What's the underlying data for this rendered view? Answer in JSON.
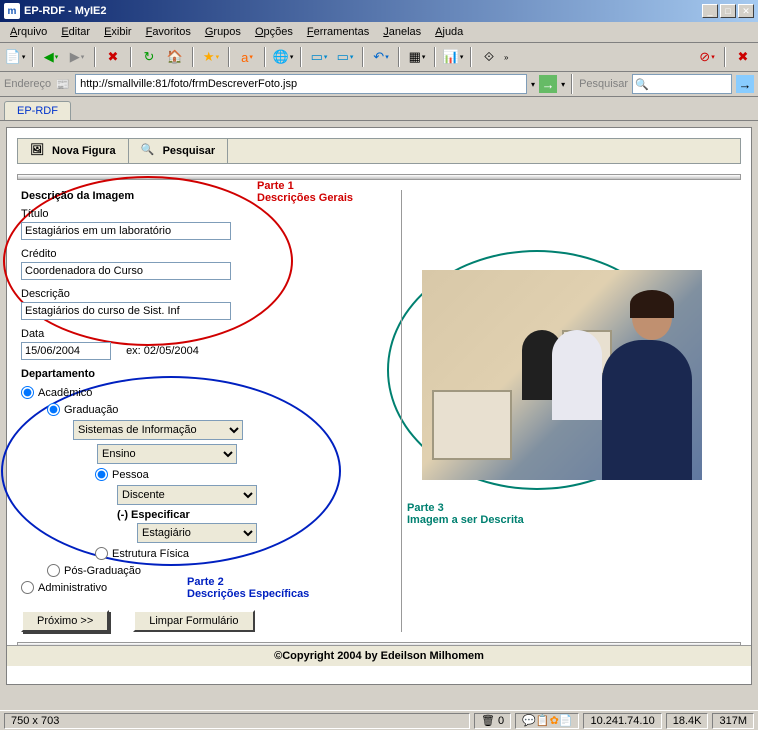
{
  "window": {
    "title": "EP-RDF - MyIE2"
  },
  "menu": {
    "items": [
      "Arquivo",
      "Editar",
      "Exibir",
      "Favoritos",
      "Grupos",
      "Opções",
      "Ferramentas",
      "Janelas",
      "Ajuda"
    ]
  },
  "address": {
    "label": "Endereço",
    "url": "http://smallville:81/foto/frmDescreverFoto.jsp",
    "search_label": "Pesquisar"
  },
  "tab": {
    "label": "EP-RDF"
  },
  "innertabs": {
    "nova": "Nova Figura",
    "pesquisar": "Pesquisar"
  },
  "form": {
    "section": "Descrição da Imagem",
    "titulo_label": "Título",
    "titulo_value": "Estagiários em um laboratório",
    "credito_label": "Crédito",
    "credito_value": "Coordenadora do Curso",
    "descricao_label": "Descrição",
    "descricao_value": "Estagiários do curso de Sist. Inf",
    "data_label": "Data",
    "data_value": "15/06/2004",
    "data_ex": "ex: 02/05/2004",
    "departamento": "Departamento",
    "academico": "Acadêmico",
    "graduacao": "Graduação",
    "sel_sistemas": "Sistemas de Informação",
    "sel_ensino": "Ensino",
    "pessoa": "Pessoa",
    "sel_discente": "Discente",
    "especificar": "(-) Especificar",
    "sel_estagiario": "Estagiário",
    "estrutura": "Estrutura Física",
    "posgrad": "Pós-Graduação",
    "administrativo": "Administrativo",
    "btn_proximo": "Próximo >>",
    "btn_limpar": "Limpar Formulário"
  },
  "annotations": {
    "parte1a": "Parte 1",
    "parte1b": "Descrições Gerais",
    "parte2a": "Parte 2",
    "parte2b": "Descrições Específicas",
    "parte3a": "Parte 3",
    "parte3b": "Imagem a ser Descrita"
  },
  "footer": {
    "copyright": "©Copyright 2004 by Edeilson Milhomem"
  },
  "status": {
    "dims": "750 x 703",
    "trash": "0",
    "ip": "10.241.74.10",
    "down": "18.4K",
    "total": "317M"
  }
}
